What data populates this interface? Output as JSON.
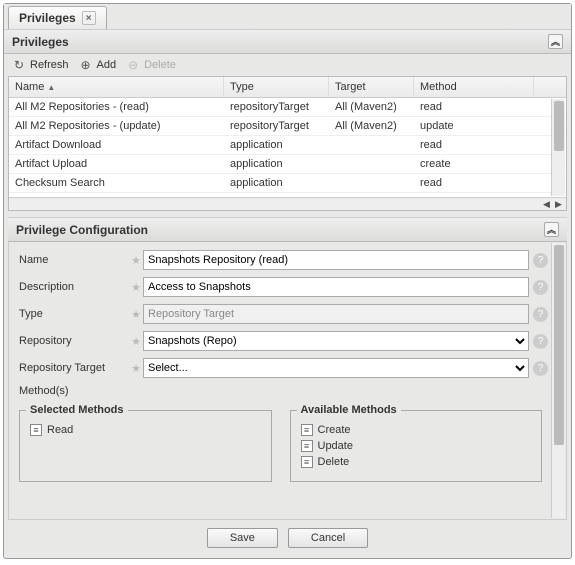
{
  "tab": {
    "title": "Privileges"
  },
  "panel": {
    "title": "Privileges"
  },
  "toolbar": {
    "refresh": "Refresh",
    "add": "Add",
    "delete": "Delete"
  },
  "grid": {
    "columns": {
      "name": "Name",
      "type": "Type",
      "target": "Target",
      "method": "Method"
    },
    "rows": [
      {
        "name": "All M2 Repositories - (read)",
        "type": "repositoryTarget",
        "target": "All (Maven2)",
        "method": "read"
      },
      {
        "name": "All M2 Repositories - (update)",
        "type": "repositoryTarget",
        "target": "All (Maven2)",
        "method": "update"
      },
      {
        "name": "Artifact Download",
        "type": "application",
        "target": "",
        "method": "read"
      },
      {
        "name": "Artifact Upload",
        "type": "application",
        "target": "",
        "method": "create"
      },
      {
        "name": "Checksum Search",
        "type": "application",
        "target": "",
        "method": "read"
      }
    ]
  },
  "config": {
    "title": "Privilege Configuration",
    "labels": {
      "name": "Name",
      "description": "Description",
      "type": "Type",
      "repository": "Repository",
      "repositoryTarget": "Repository Target",
      "methods": "Method(s)"
    },
    "values": {
      "name": "Snapshots Repository (read)",
      "description": "Access to Snapshots",
      "type": "Repository Target",
      "repository": "Snapshots (Repo)",
      "repositoryTarget": "Select..."
    },
    "selectedMethods": {
      "title": "Selected Methods",
      "items": [
        "Read"
      ]
    },
    "availableMethods": {
      "title": "Available Methods",
      "items": [
        "Create",
        "Update",
        "Delete"
      ]
    }
  },
  "buttons": {
    "save": "Save",
    "cancel": "Cancel"
  }
}
